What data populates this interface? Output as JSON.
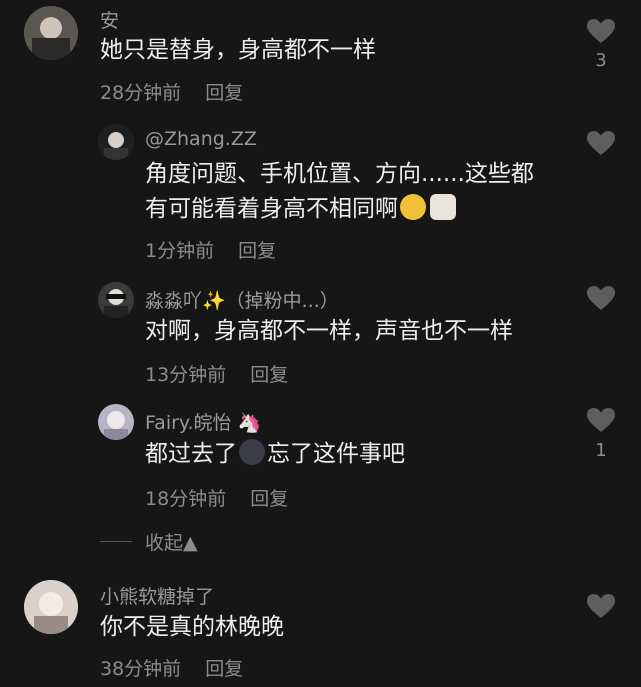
{
  "comments": [
    {
      "user": "安",
      "text": "她只是替身，身高都不一样",
      "time": "28分钟前",
      "reply": "回复",
      "likes": "3"
    },
    {
      "user": "@Zhang.ZZ",
      "text_line1": "角度问题、手机位置、方向......这些都",
      "text_line2": "有可能看着身高不相同啊",
      "time": "1分钟前",
      "reply": "回复"
    },
    {
      "user": "淼淼吖✨（掉粉中...）",
      "text": "对啊，身高都不一样，声音也不一样",
      "time": "13分钟前",
      "reply": "回复"
    },
    {
      "user": "Fairy.皖怡 🦄",
      "text_before": "都过去了",
      "text_after": "忘了这件事吧",
      "time": "18分钟前",
      "reply": "回复",
      "likes": "1"
    },
    {
      "user": "小熊软糖掉了",
      "text": "你不是真的林晚晚",
      "time": "38分钟前",
      "reply": "回复"
    }
  ],
  "collapse_label": "收起▲",
  "colors": {
    "background": "#161616",
    "heart": "#5e5e5e"
  }
}
